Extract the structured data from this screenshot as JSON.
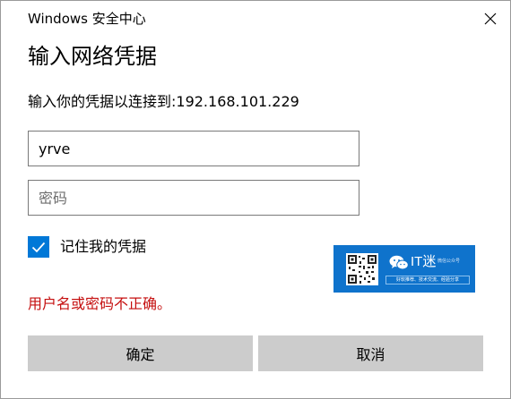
{
  "window": {
    "title": "Windows 安全中心",
    "close_icon": "close-icon"
  },
  "dialog": {
    "heading": "输入网络凭据",
    "prompt": "输入你的凭据以连接到:192.168.101.229",
    "username": {
      "value": "yrve",
      "placeholder": ""
    },
    "password": {
      "value": "",
      "placeholder": "密码"
    },
    "remember": {
      "label": "记住我的凭据",
      "checked": true
    },
    "error_message": "用户名或密码不正确。",
    "buttons": {
      "ok_label": "确定",
      "cancel_label": "取消"
    }
  },
  "watermark": {
    "name": "IT迷",
    "tag": "微信公众号",
    "slogan": "好软推荐、技术交流、经验分享",
    "icons": [
      "qr-code-icon",
      "wechat-icon"
    ]
  },
  "colors": {
    "accent": "#0078d7",
    "button_bg": "#cccccc",
    "error": "#c50f0f",
    "watermark_bg": "#0f73cc"
  }
}
